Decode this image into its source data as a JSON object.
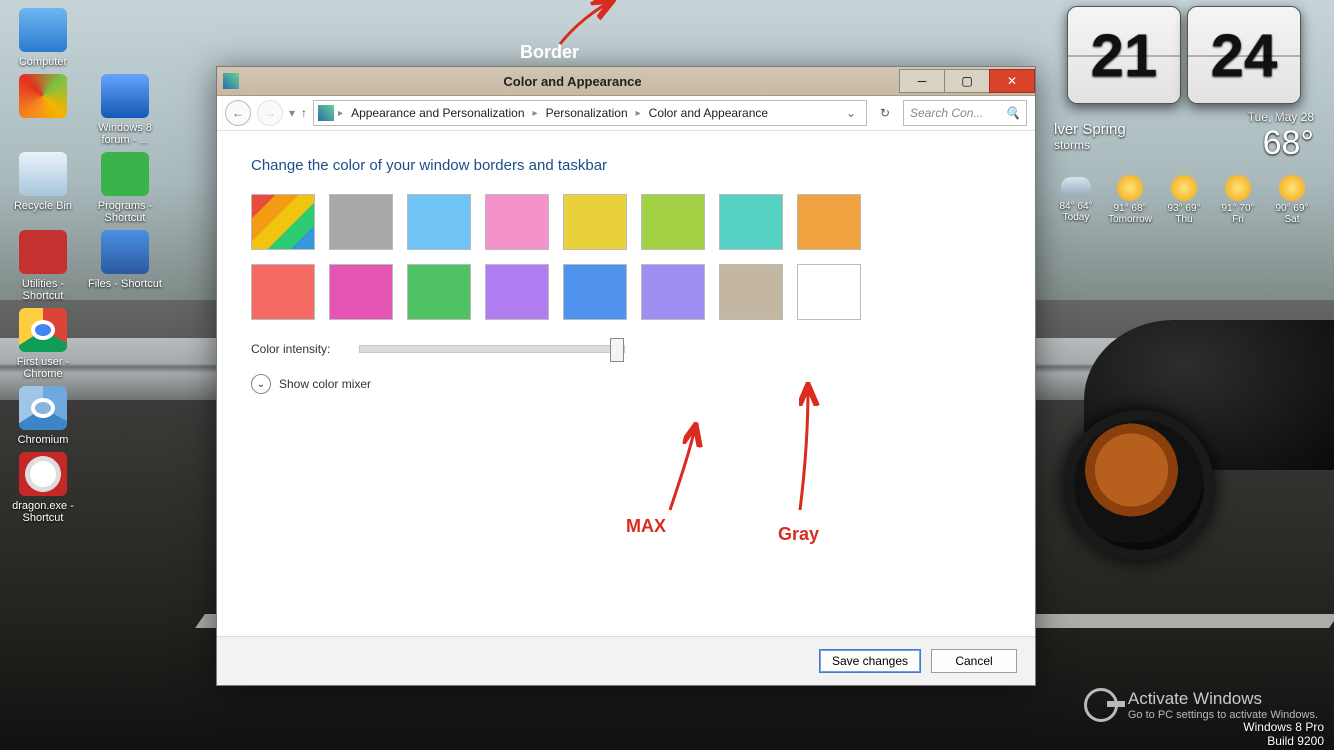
{
  "desktop_icons": [
    [
      {
        "label": "Computer",
        "glyph": "gl-computer"
      }
    ],
    [
      {
        "label": "",
        "glyph": "gl-ie",
        "hidden_label": true
      },
      {
        "label": "Windows 8 forum - ...",
        "glyph": "gl-forum"
      }
    ],
    [
      {
        "label": "Recycle Bin",
        "glyph": "gl-bin"
      },
      {
        "label": "Programs - Shortcut",
        "glyph": "gl-prog"
      }
    ],
    [
      {
        "label": "Utilities - Shortcut",
        "glyph": "gl-util"
      },
      {
        "label": "Files - Shortcut",
        "glyph": "gl-files"
      }
    ],
    [
      {
        "label": "First user - Chrome",
        "glyph": "gl-chrome"
      }
    ],
    [
      {
        "label": "Chromium",
        "glyph": "gl-chromium"
      }
    ],
    [
      {
        "label": "dragon.exe - Shortcut",
        "glyph": "gl-dragon"
      }
    ]
  ],
  "window": {
    "title": "Color and Appearance",
    "breadcrumb": [
      "Appearance and Personalization",
      "Personalization",
      "Color and Appearance"
    ],
    "search_placeholder": "Search Con...",
    "headline": "Change the color of your window borders and taskbar",
    "swatches": [
      {
        "name": "automatic",
        "class": "auto",
        "color": ""
      },
      {
        "name": "gray",
        "color": "#a9a9a9"
      },
      {
        "name": "sky",
        "color": "#6fc3f5"
      },
      {
        "name": "pink",
        "color": "#f492cc"
      },
      {
        "name": "yellow",
        "color": "#e8d13a"
      },
      {
        "name": "lime",
        "color": "#a3d145"
      },
      {
        "name": "teal",
        "color": "#55d2c3"
      },
      {
        "name": "orange",
        "color": "#f2a341"
      },
      {
        "name": "coral",
        "color": "#f56b63"
      },
      {
        "name": "magenta",
        "color": "#e455b3"
      },
      {
        "name": "green",
        "color": "#4fc264"
      },
      {
        "name": "violet",
        "color": "#b07df0"
      },
      {
        "name": "blue",
        "color": "#4f93ef"
      },
      {
        "name": "lavender",
        "color": "#9d8ff2"
      },
      {
        "name": "taupe",
        "color": "#c4b7a1"
      },
      {
        "name": "white",
        "color": "#ffffff"
      }
    ],
    "intensity_label": "Color intensity:",
    "mixer_label": "Show color mixer",
    "save_label": "Save changes",
    "cancel_label": "Cancel"
  },
  "widget": {
    "hour": "21",
    "minute": "24",
    "city": "lver Spring",
    "condition": "storms",
    "date": "Tue, May 28",
    "temp": "68°",
    "forecast": [
      {
        "day": "Today",
        "hi": "84°",
        "lo": "64°",
        "icon": "cloud"
      },
      {
        "day": "Tomorrow",
        "hi": "91°",
        "lo": "68°",
        "icon": "sun"
      },
      {
        "day": "Thu",
        "hi": "93°",
        "lo": "69°",
        "icon": "sun"
      },
      {
        "day": "Fri",
        "hi": "91°",
        "lo": "70°",
        "icon": "sun"
      },
      {
        "day": "Sat",
        "hi": "90°",
        "lo": "69°",
        "icon": "sun"
      }
    ]
  },
  "annotations": {
    "border": "Border",
    "max": "MAX",
    "gray": "Gray"
  },
  "watermark": {
    "title": "Activate Windows",
    "sub": "Go to PC settings to activate Windows."
  },
  "build": {
    "line1": "Windows 8 Pro",
    "line2": "Build 9200"
  }
}
